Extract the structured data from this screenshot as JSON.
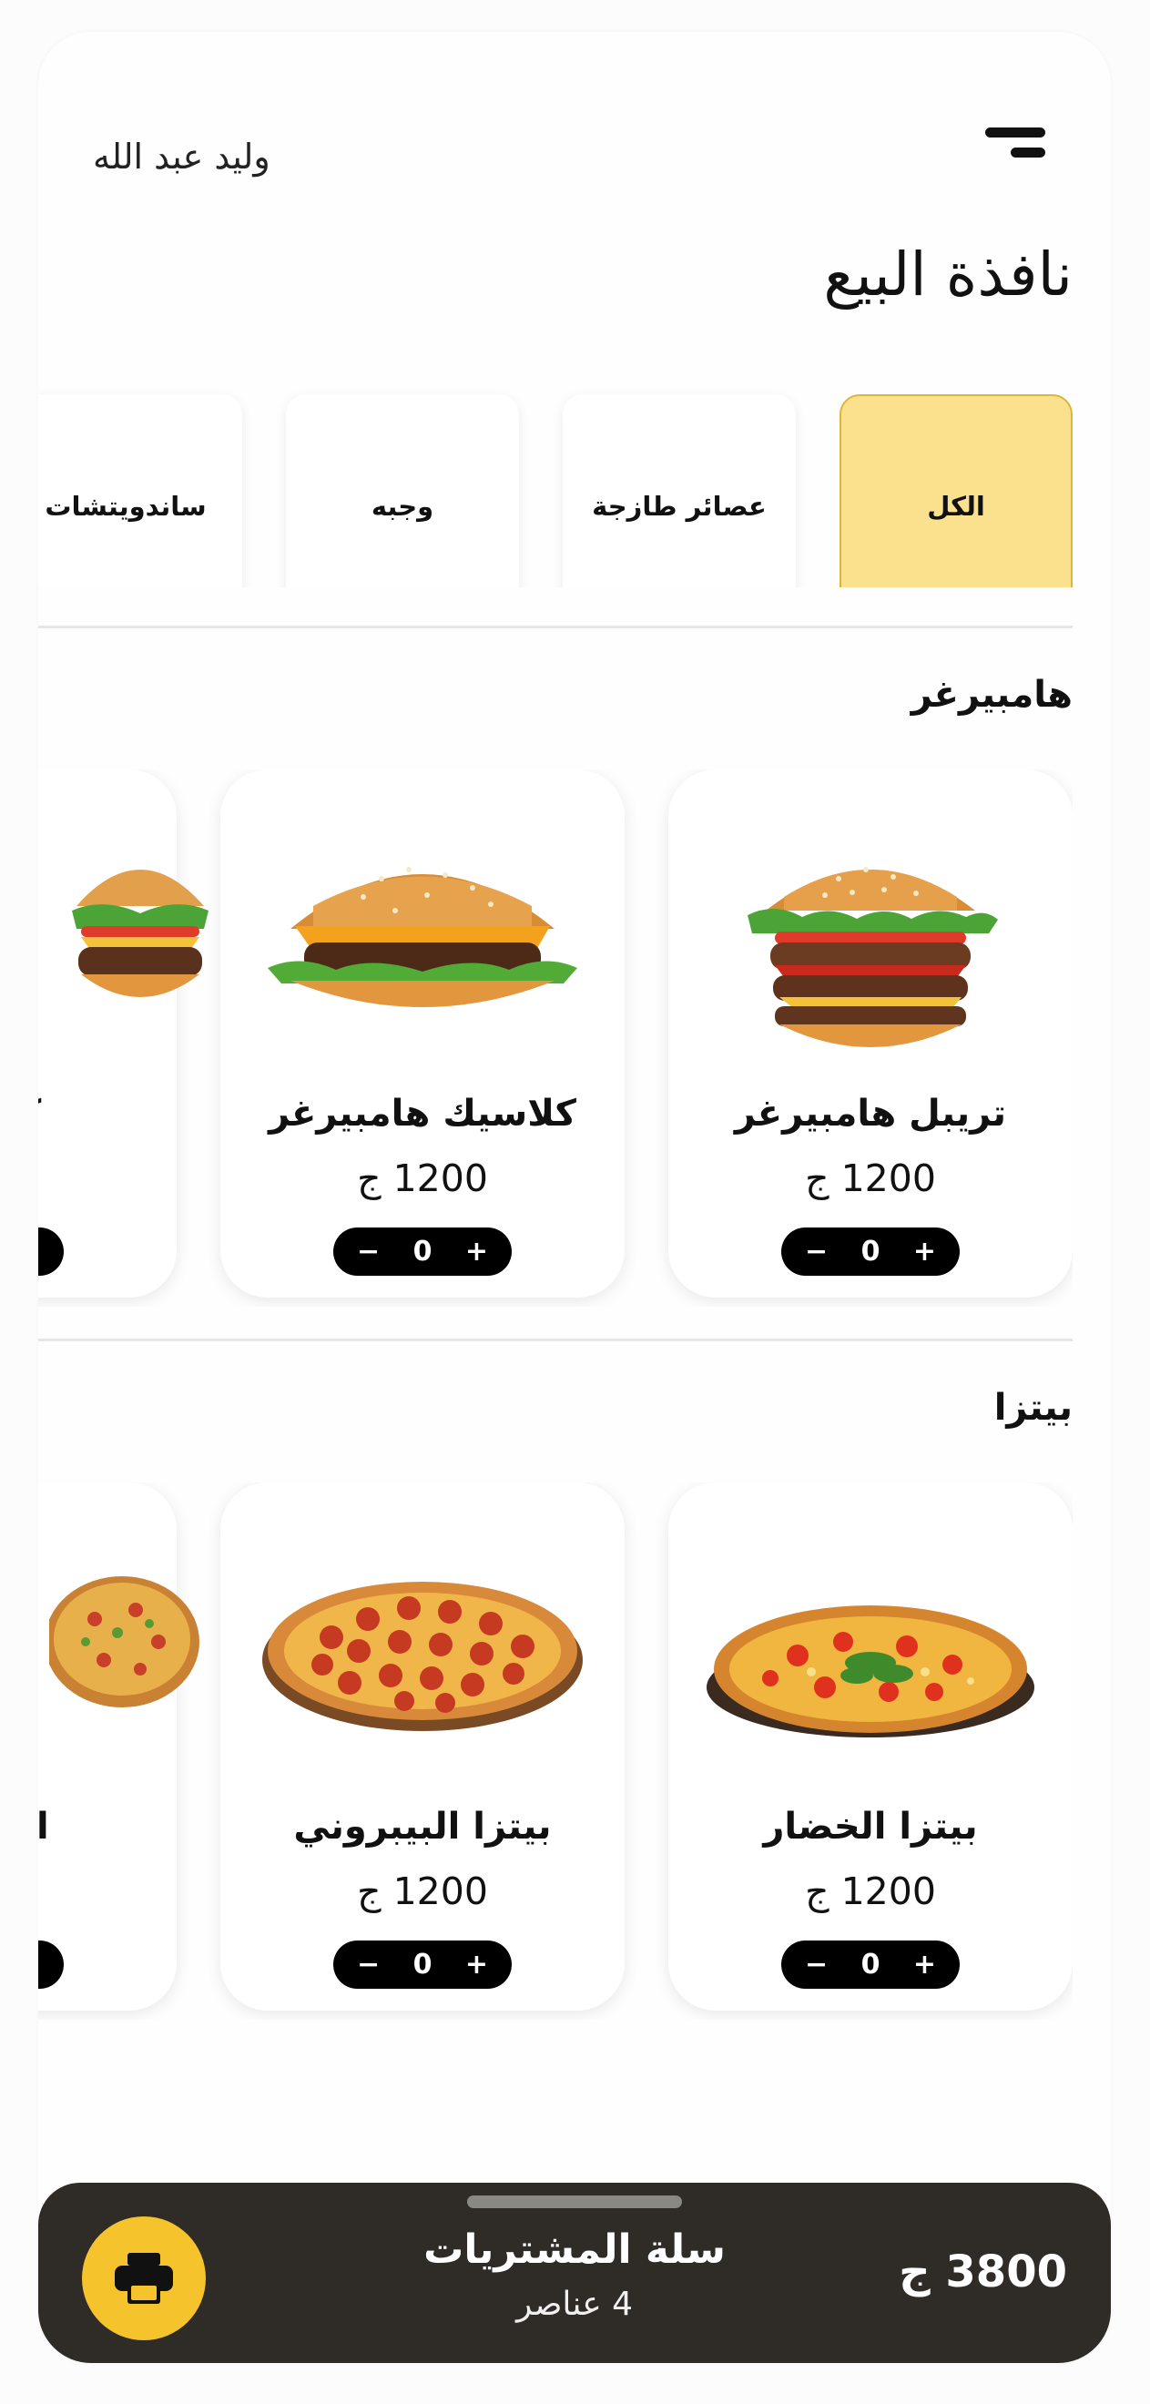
{
  "header": {
    "user_name": "وليد عبد الله",
    "menu_icon": "menu-icon"
  },
  "page_title": "نافذة البيع",
  "categories": [
    {
      "label": "الكل",
      "active": true
    },
    {
      "label": "عصائر طازجة"
    },
    {
      "label": "وجبه"
    },
    {
      "label": "ساندويتشات"
    }
  ],
  "sections": [
    {
      "title": "هامبيرغر",
      "items": [
        {
          "name": "تريبل هامبيرغر",
          "price": "1200 ج",
          "qty": "0"
        },
        {
          "name": "كلاسيك هامبيرغر",
          "price": "1200 ج",
          "qty": "0"
        },
        {
          "name": "كلاسيك",
          "price": "",
          "qty": ""
        }
      ]
    },
    {
      "title": "بيتزا",
      "items": [
        {
          "name": "بيتزا الخضار",
          "price": "1200 ج",
          "qty": "0"
        },
        {
          "name": "بيتزا البيبروني",
          "price": "1200 ج",
          "qty": "0"
        },
        {
          "name": "البرتقال",
          "price": "",
          "qty": ""
        }
      ]
    }
  ],
  "stepper": {
    "minus": "−",
    "plus": "+"
  },
  "cart": {
    "title": "سلة المشتريات",
    "count": "4 عناصر",
    "total": "3800 ج",
    "icon": "printer-icon"
  },
  "colors": {
    "accent": "#f5c42c",
    "active_category": "#fbe08d",
    "cart_bg": "#2f2c28"
  }
}
